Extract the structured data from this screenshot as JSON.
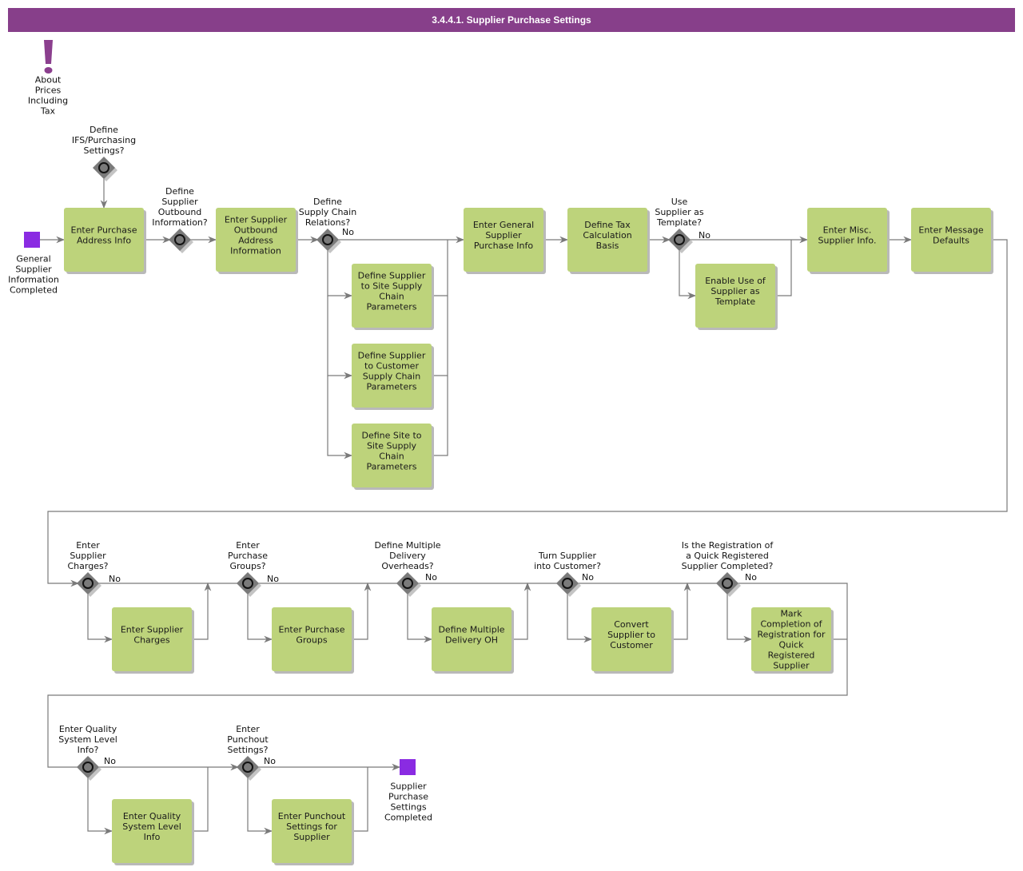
{
  "header": {
    "title": "3.4.4.1. Supplier Purchase Settings"
  },
  "colors": {
    "title_bar": "#873f8a",
    "task": "#bdd37b",
    "gateway": "#7a7a7a",
    "event": "#8a2be2",
    "flow": "#7a7a7a"
  },
  "annotation": {
    "icon": "exclamation-icon",
    "label": [
      "About",
      "Prices",
      "Including",
      "Tax"
    ]
  },
  "start_event": {
    "label": [
      "General",
      "Supplier",
      "Information",
      "Completed"
    ]
  },
  "end_event": {
    "label": [
      "Supplier",
      "Purchase",
      "Settings",
      "Completed"
    ]
  },
  "no_label": "No",
  "gateways": [
    {
      "id": "g_ifs",
      "label": [
        "Define",
        "IFS/Purchasing",
        "Settings?"
      ],
      "has_no": false
    },
    {
      "id": "g_outbound",
      "label": [
        "Define",
        "Supplier",
        "Outbound",
        "Information?"
      ],
      "has_no": false
    },
    {
      "id": "g_supply",
      "label": [
        "Define",
        "Supply Chain",
        "Relations?"
      ],
      "has_no": true
    },
    {
      "id": "g_template",
      "label": [
        "Use",
        "Supplier as",
        "Template?"
      ],
      "has_no": true
    },
    {
      "id": "g_charges",
      "label": [
        "Enter",
        "Supplier",
        "Charges?"
      ],
      "has_no": true
    },
    {
      "id": "g_groups",
      "label": [
        "Enter",
        "Purchase",
        "Groups?"
      ],
      "has_no": true
    },
    {
      "id": "g_overheads",
      "label": [
        "Define Multiple",
        "Delivery",
        "Overheads?"
      ],
      "has_no": true
    },
    {
      "id": "g_customer",
      "label": [
        "Turn Supplier",
        "into Customer?"
      ],
      "has_no": true
    },
    {
      "id": "g_quick",
      "label": [
        "Is the Registration of",
        "a Quick Registered",
        "Supplier Completed?"
      ],
      "has_no": true
    },
    {
      "id": "g_quality",
      "label": [
        "Enter Quality",
        "System Level",
        "Info?"
      ],
      "has_no": true
    },
    {
      "id": "g_punchout",
      "label": [
        "Enter",
        "Punchout",
        "Settings?"
      ],
      "has_no": true
    }
  ],
  "tasks": [
    {
      "id": "t_purchase_addr",
      "label": [
        "Enter Purchase",
        "Address Info"
      ]
    },
    {
      "id": "t_outbound_addr",
      "label": [
        "Enter Supplier",
        "Outbound",
        "Address",
        "Information"
      ]
    },
    {
      "id": "t_site_sc",
      "label": [
        "Define Supplier",
        "to Site Supply",
        "Chain",
        "Parameters"
      ]
    },
    {
      "id": "t_cust_sc",
      "label": [
        "Define Supplier",
        "to Customer",
        "Supply Chain",
        "Parameters"
      ]
    },
    {
      "id": "t_site_site",
      "label": [
        "Define Site to",
        "Site Supply",
        "Chain",
        "Parameters"
      ]
    },
    {
      "id": "t_general",
      "label": [
        "Enter General",
        "Supplier",
        "Purchase Info"
      ]
    },
    {
      "id": "t_tax",
      "label": [
        "Define Tax",
        "Calculation",
        "Basis"
      ]
    },
    {
      "id": "t_template",
      "label": [
        "Enable Use of",
        "Supplier as",
        "Template"
      ]
    },
    {
      "id": "t_misc",
      "label": [
        "Enter Misc.",
        "Supplier Info."
      ]
    },
    {
      "id": "t_message",
      "label": [
        "Enter Message",
        "Defaults"
      ]
    },
    {
      "id": "t_charges",
      "label": [
        "Enter Supplier",
        "Charges"
      ]
    },
    {
      "id": "t_groups",
      "label": [
        "Enter Purchase",
        "Groups"
      ]
    },
    {
      "id": "t_delivery",
      "label": [
        "Define Multiple",
        "Delivery OH"
      ]
    },
    {
      "id": "t_convert",
      "label": [
        "Convert",
        "Supplier to",
        "Customer"
      ]
    },
    {
      "id": "t_quick",
      "label": [
        "Mark",
        "Completion of",
        "Registration for",
        "Quick",
        "Registered",
        "Supplier"
      ]
    },
    {
      "id": "t_quality",
      "label": [
        "Enter Quality",
        "System Level",
        "Info"
      ]
    },
    {
      "id": "t_punchout",
      "label": [
        "Enter Punchout",
        "Settings for",
        "Supplier"
      ]
    }
  ]
}
